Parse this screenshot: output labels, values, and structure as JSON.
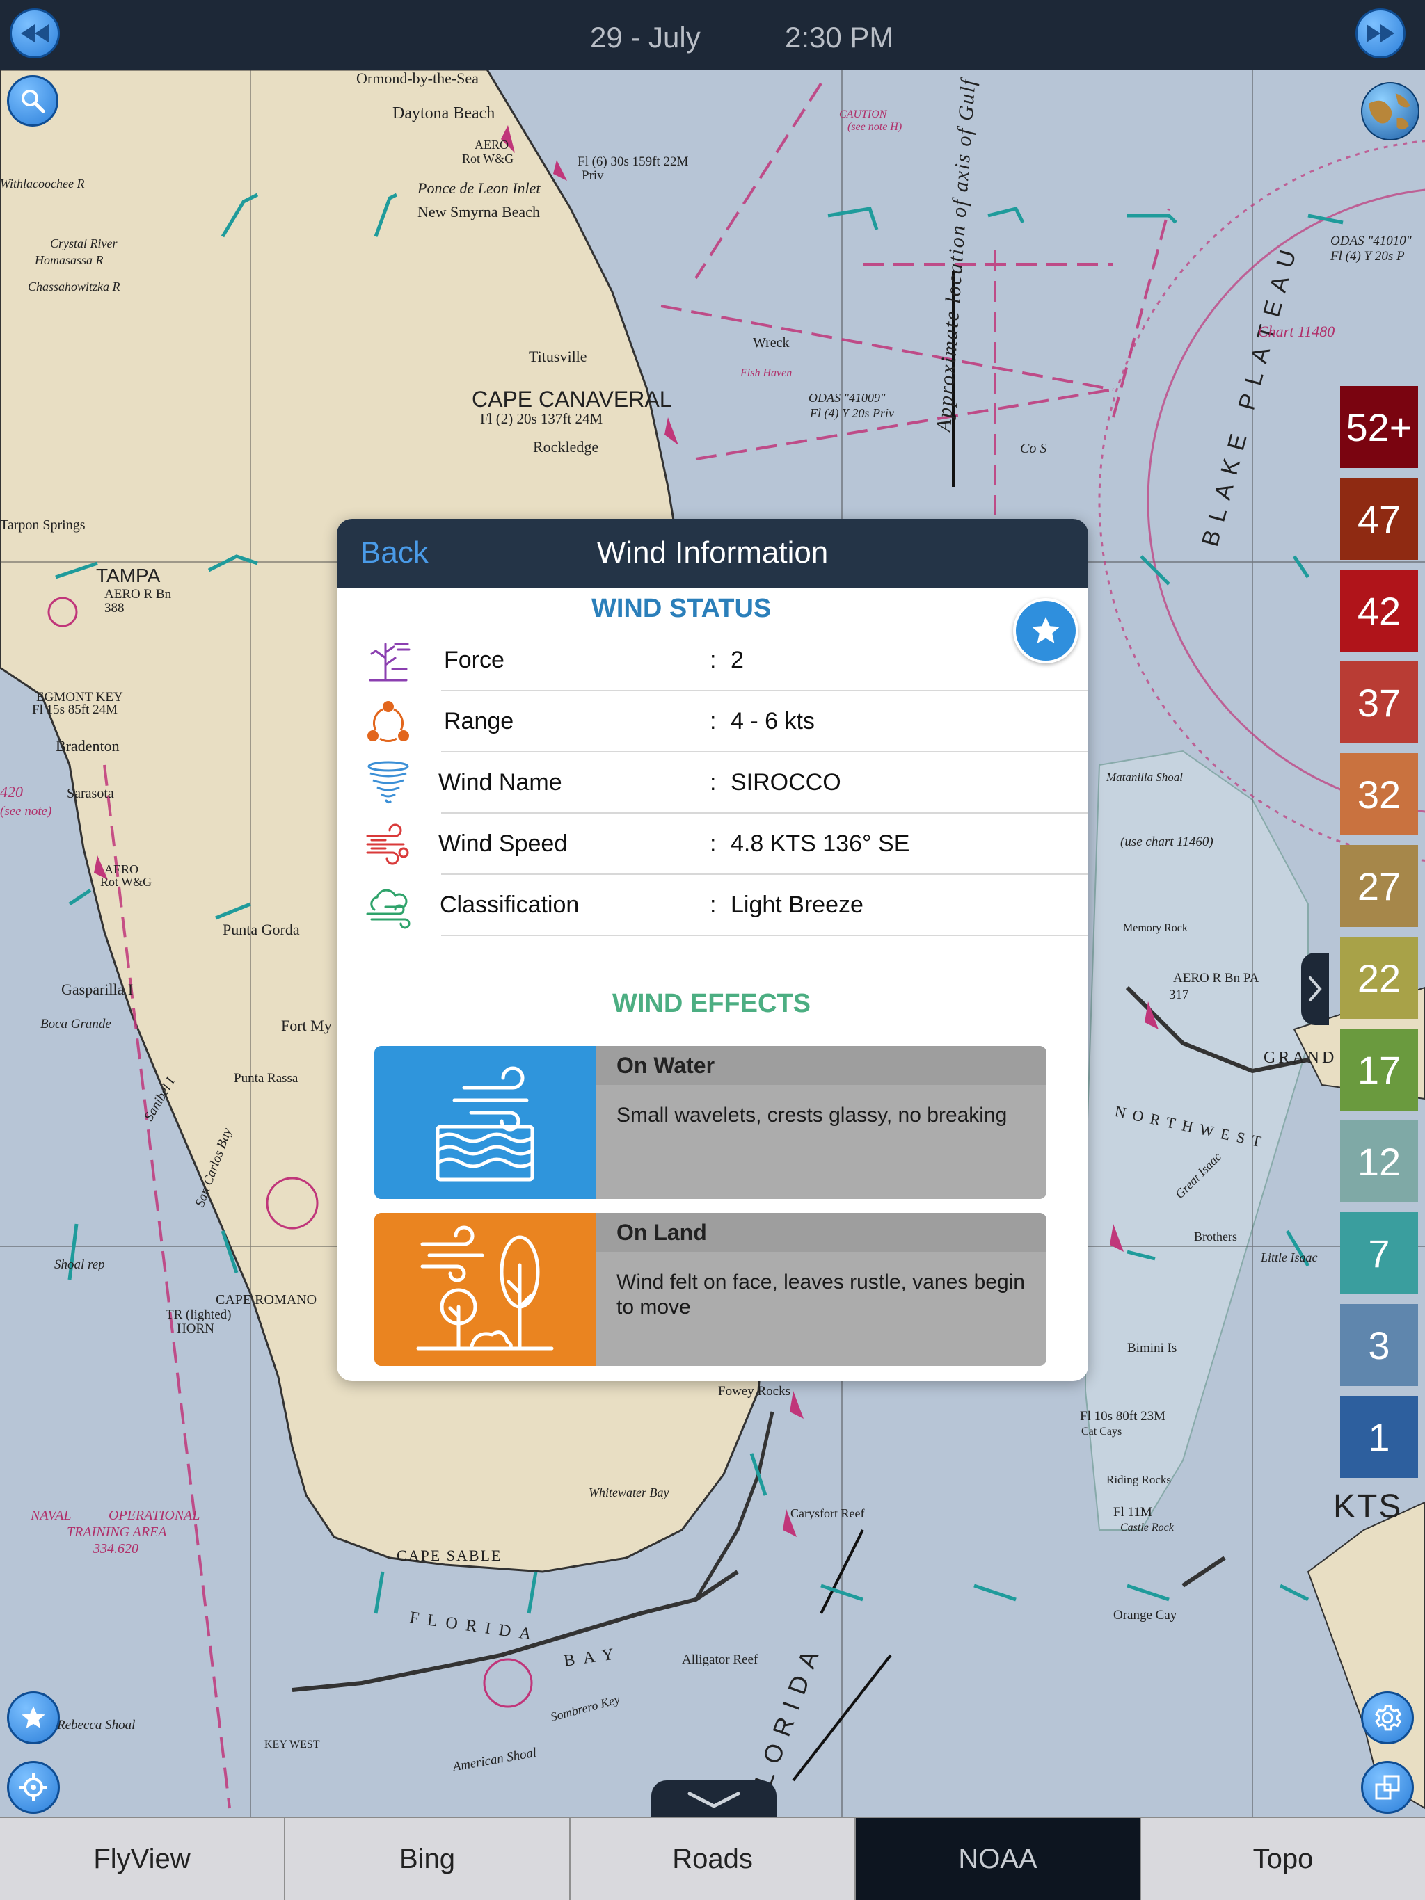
{
  "top_bar": {
    "date": "29 - July",
    "time": "2:30 PM",
    "rewind_icon": "rewind-icon",
    "forward_icon": "fast-forward-icon"
  },
  "map": {
    "labels": [
      "Ormond-by-the-Sea",
      "Daytona Beach",
      "AERO",
      "Rot W&G",
      "Ponce de Leon Inlet",
      "New Smyrna Beach",
      "Fl (6) 30s 159ft 22M",
      "Priv",
      "Withlacoochee R",
      "Crystal River",
      "Homasassa R",
      "Chassahowitzka R",
      "Titusville",
      "CAPE CANAVERAL",
      "Fl (2) 20s 137ft 24M",
      "Rockledge",
      "Tarpon Springs",
      "TAMPA",
      "AERO R Bn",
      "388",
      "EGMONT KEY",
      "Fl 15s 85ft 24M",
      "Bradenton",
      "Sarasota",
      "AERO",
      "Rot W&G",
      "Punta Gorda",
      "Gasparilla I",
      "Boca Grande",
      "Fort My",
      "Punta Rassa",
      "Sanibel I",
      "San Carlos Bay",
      "CAPE ROMANO",
      "Shoal rep",
      "TR (lighted)",
      "HORN",
      "NAVAL",
      "OPERATIONAL",
      "TRAINING AREA",
      "334.620",
      "CAPE SABLE",
      "Whitewater Bay",
      "FLORIDA",
      "BAY",
      "Fowey Rocks",
      "Carysfort Reef",
      "Alligator Reef",
      "Rebecca Shoal",
      "American Shoal",
      "Sombrero Key",
      "KEY WEST",
      "ODAS \"41009\"",
      "Fl (4) Y 20s Priv",
      "Wreck",
      "Fish Haven",
      "Approximate location of axis of Gulf",
      "BLAKE PLATEAU",
      "Chart 11480",
      "ODAS \"41010\"",
      "Fl (4) Y 20s P",
      "Matanilla Shoal",
      "(use chart 11460)",
      "Memory Rock",
      "AERO R Bn PA",
      "317",
      "Great Isaac",
      "NORTHWEST",
      "Brothers",
      "Little Isaac",
      "Bimini Is",
      "Fl 10s 80ft 23M",
      "Cat Cays",
      "Riding Rocks",
      "Fl 11M",
      "Castle Rock",
      "Orange Cay",
      "FLORIDA",
      "GRAND",
      "CAUTION",
      "(see note H)",
      "Co S",
      "420",
      "(see note)"
    ]
  },
  "search_icon": "search-icon",
  "globe_icon": "globe-icon",
  "legend": {
    "values": [
      "52+",
      "47",
      "42",
      "37",
      "32",
      "27",
      "22",
      "17",
      "12",
      "7",
      "3",
      "1"
    ],
    "colors": [
      "#7a0410",
      "#8f2a12",
      "#b0141a",
      "#b93c34",
      "#c9723f",
      "#a6874a",
      "#a8a248",
      "#6a9a3e",
      "#7fa9a6",
      "#3a9e9e",
      "#5f86ad",
      "#2d5f9e"
    ],
    "unit": "KTS"
  },
  "modal": {
    "back_label": "Back",
    "title": "Wind Information",
    "status_title": "WIND STATUS",
    "effects_title": "WIND EFFECTS",
    "favorite_icon": "star-icon",
    "status_rows": [
      {
        "label": "Force",
        "colon": ":",
        "value": "2",
        "icon": "plant-wind-icon",
        "color": "#8b3fb0"
      },
      {
        "label": "Range",
        "colon": ":",
        "value": "4 - 6  kts",
        "icon": "range-cycle-icon",
        "color": "#e2661d"
      },
      {
        "label": "Wind Name",
        "colon": ":",
        "value": "SIROCCO",
        "icon": "tornado-icon",
        "color": "#3b8fd6"
      },
      {
        "label": "Wind Speed",
        "colon": ":",
        "value": "4.8 KTS 136° SE",
        "icon": "wind-speed-icon",
        "color": "#d93a3a"
      },
      {
        "label": "Classification",
        "colon": ":",
        "value": "Light Breeze",
        "icon": "cloud-wind-icon",
        "color": "#2fa36b"
      }
    ],
    "effects": [
      {
        "title": "On Water",
        "description": "Small wavelets, crests glassy, no breaking",
        "color": "#2f95dc",
        "icon": "water-waves-icon"
      },
      {
        "title": "On Land",
        "description": "Wind felt on face, leaves rustle, vanes begin to move",
        "color": "#ea8420",
        "icon": "trees-wind-icon"
      }
    ],
    "colors": {
      "status_title": "#2b7fba",
      "effects_title": "#4cae82"
    }
  },
  "side_handle_icon": "chevron-right-icon",
  "drawer_icon": "chevron-down-icon",
  "bottom_left_buttons": {
    "favorites": "star-icon",
    "locate": "crosshair-icon"
  },
  "bottom_right_buttons": {
    "settings": "gear-icon",
    "layers": "layers-icon"
  },
  "tabs": [
    "FlyView",
    "Bing",
    "Roads",
    "NOAA",
    "Topo"
  ],
  "active_tab": "NOAA"
}
